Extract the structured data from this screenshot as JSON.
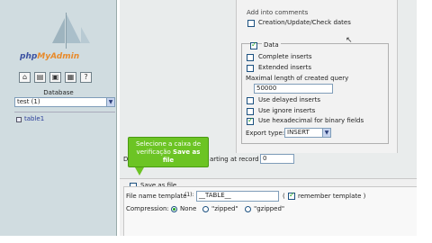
{
  "sidebar": {
    "logo_text_a": "php",
    "logo_text_b": "MyAdmin",
    "icons": [
      "home-icon",
      "sql-icon",
      "query-window-icon",
      "docs-icon",
      "help-icon"
    ],
    "database_label": "Database",
    "database_select": "test (1)",
    "tables": [
      "table1"
    ]
  },
  "content": {
    "top_partial": "Add into comments",
    "creation_dates": "Creation/Update/Check dates",
    "data_legend": "Data",
    "complete_inserts": "Complete inserts",
    "extended_inserts": "Extended inserts",
    "max_length_label": "Maximal length of created query",
    "max_length_value": "50000",
    "delayed_inserts": "Use delayed inserts",
    "ignore_inserts": "Use ignore inserts",
    "hex_binary": "Use hexadecimal for binary fields",
    "export_type_label": "Export type:",
    "export_type_value": "INSERT",
    "starting_row_prefix": "D",
    "starting_row_label": "arting at record #",
    "starting_row_value": "0",
    "save_as_file": "Save as file",
    "file_template_label": "File name template",
    "file_template_hint": "(1):",
    "file_template_value": "__TABLE__",
    "remember_template": "remember template )",
    "compression_label": "Compression:",
    "compression_options": [
      "None",
      "\"zipped\"",
      "\"gzipped\""
    ]
  },
  "tooltip": {
    "line1": "Selecione a caixa de",
    "line2": "verificação",
    "line2_bold": "Save as",
    "line3_bold": "file"
  },
  "colors": {
    "tooltip_green": "#6cc424",
    "sidebar_bg": "#d0dce0",
    "checkbox_check": "#21a121"
  }
}
